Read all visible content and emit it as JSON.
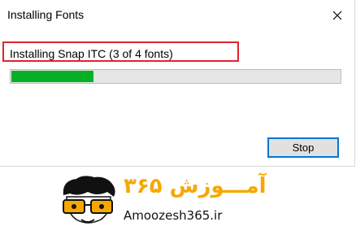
{
  "window": {
    "title": "Installing Fonts",
    "close_icon": "close-icon"
  },
  "status": {
    "text": "Installing Snap ITC (3 of 4 fonts)",
    "highlight_color": "#e1232e"
  },
  "progress": {
    "fraction": 0.25,
    "fill_color": "#06b025"
  },
  "buttons": {
    "stop_label": "Stop",
    "focus_color": "#0078d7"
  },
  "watermark": {
    "persian_text": "آمـــوزش ۳۶۵",
    "site_text": "Amoozesh365.ir",
    "accent_color": "#f6a800"
  }
}
